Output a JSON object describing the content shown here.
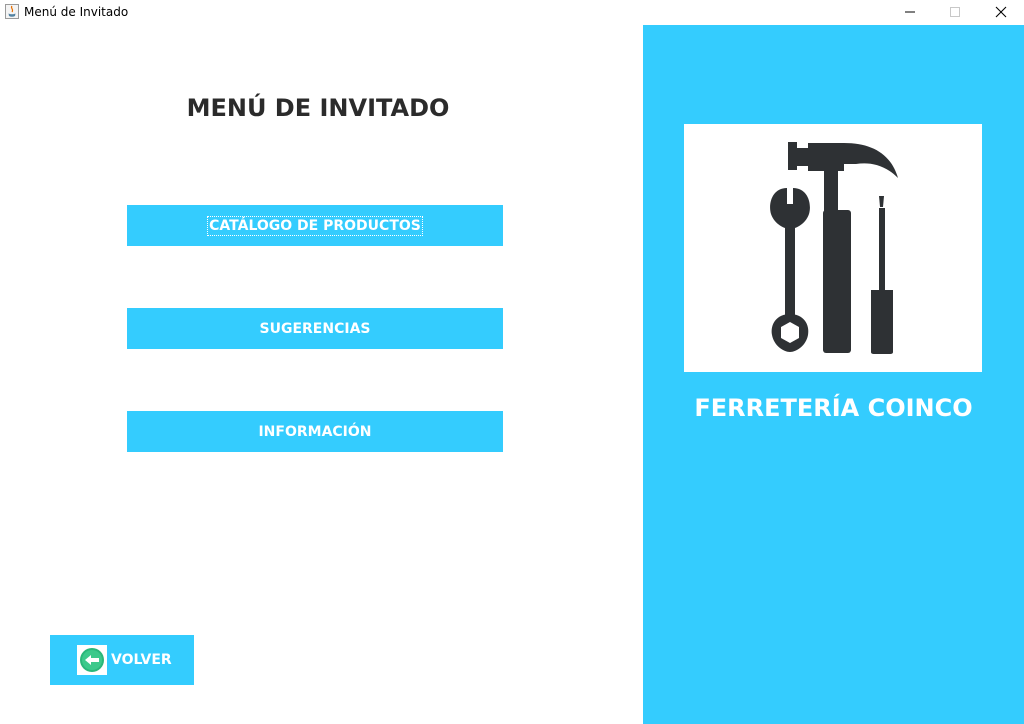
{
  "window": {
    "title": "Menú de Invitado"
  },
  "main": {
    "title": "MENÚ DE INVITADO",
    "buttons": [
      {
        "label": "CATÁLOGO DE PRODUCTOS"
      },
      {
        "label": "SUGERENCIAS"
      },
      {
        "label": "INFORMACIÓN"
      }
    ],
    "back": {
      "label": "VOLVER",
      "icon": "arrow-left-circle-icon"
    }
  },
  "side": {
    "brand": "FERRETERÍA COINCO",
    "logo": "tools-icon"
  },
  "colors": {
    "accent": "#34ccfe",
    "text_dark": "#2b2b2b",
    "icon_dark": "#2e3134",
    "back_icon_green": "#2ab77a"
  }
}
